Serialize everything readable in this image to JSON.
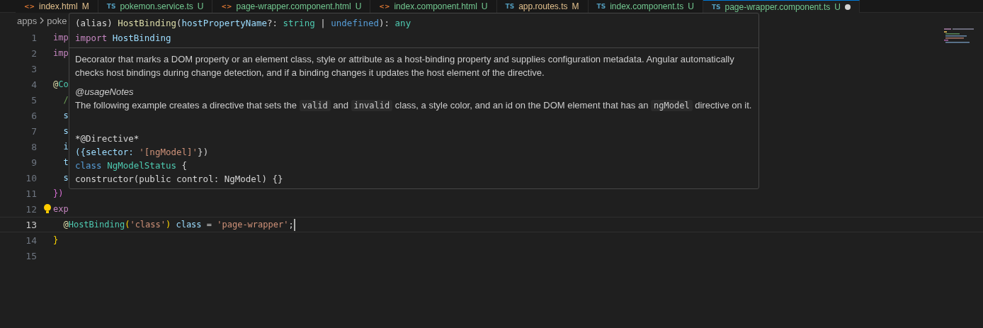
{
  "tabs": [
    {
      "kind": "html",
      "badge": "<>",
      "label": "index.html",
      "status": "M",
      "color": "#e2c08d",
      "selected": false,
      "dirty": false
    },
    {
      "kind": "ts",
      "badge": "TS",
      "label": "pokemon.service.ts",
      "status": "U",
      "color": "#73c991",
      "selected": false,
      "dirty": false
    },
    {
      "kind": "html",
      "badge": "<>",
      "label": "page-wrapper.component.html",
      "status": "U",
      "color": "#73c991",
      "selected": false,
      "dirty": false
    },
    {
      "kind": "html",
      "badge": "<>",
      "label": "index.component.html",
      "status": "U",
      "color": "#73c991",
      "selected": false,
      "dirty": false
    },
    {
      "kind": "ts",
      "badge": "TS",
      "label": "app.routes.ts",
      "status": "M",
      "color": "#e2c08d",
      "selected": false,
      "dirty": false
    },
    {
      "kind": "ts",
      "badge": "TS",
      "label": "index.component.ts",
      "status": "U",
      "color": "#73c991",
      "selected": false,
      "dirty": false
    },
    {
      "kind": "ts",
      "badge": "TS",
      "label": "page-wrapper.component.ts",
      "status": "U",
      "color": "#73c991",
      "selected": true,
      "dirty": true
    }
  ],
  "breadcrumb": [
    "apps",
    "poke"
  ],
  "lines": [
    {
      "number": "1",
      "current": false,
      "bulb": false,
      "tokens": [
        {
          "text": "imp",
          "kind": "keyword"
        }
      ]
    },
    {
      "number": "2",
      "current": false,
      "bulb": false,
      "tokens": [
        {
          "text": "imp",
          "kind": "keyword"
        }
      ]
    },
    {
      "number": "3",
      "current": false,
      "bulb": false
    },
    {
      "number": "4",
      "current": false,
      "bulb": false,
      "tokens": [
        {
          "text": "@",
          "kind": "func"
        },
        {
          "text": "Co",
          "kind": "type"
        }
      ]
    },
    {
      "number": "5",
      "current": false,
      "bulb": false,
      "tokens": [
        {
          "text": "  /",
          "kind": "comment"
        }
      ]
    },
    {
      "number": "6",
      "current": false,
      "bulb": false,
      "tokens": [
        {
          "text": "  s",
          "kind": "variable"
        }
      ]
    },
    {
      "number": "7",
      "current": false,
      "bulb": false,
      "tokens": [
        {
          "text": "  s",
          "kind": "variable"
        }
      ]
    },
    {
      "number": "8",
      "current": false,
      "bulb": false,
      "tokens": [
        {
          "text": "  i",
          "kind": "variable"
        }
      ]
    },
    {
      "number": "9",
      "current": false,
      "bulb": false,
      "tokens": [
        {
          "text": "  t",
          "kind": "variable"
        }
      ]
    },
    {
      "number": "10",
      "current": false,
      "bulb": false,
      "tokens": [
        {
          "text": "  s",
          "kind": "variable"
        }
      ]
    },
    {
      "number": "11",
      "current": false,
      "bulb": false,
      "tokens": [
        {
          "text": "})",
          "kind": "bracket"
        }
      ]
    },
    {
      "number": "12",
      "current": false,
      "bulb": true,
      "tokens": [
        {
          "text": "exp",
          "kind": "keyword"
        }
      ]
    },
    {
      "number": "13",
      "current": true,
      "bulb": false,
      "tokens": [
        {
          "text": "  @",
          "kind": "func"
        },
        {
          "text": "HostBinding",
          "kind": "type"
        },
        {
          "text": "(",
          "kind": "bracket2"
        },
        {
          "text": "'class'",
          "kind": "string"
        },
        {
          "text": ")",
          "kind": "bracket2"
        },
        {
          "text": " class",
          "kind": "variable"
        },
        {
          "text": " = ",
          "kind": "plain"
        },
        {
          "text": "'page-wrapper'",
          "kind": "string"
        },
        {
          "text": ";",
          "kind": "plain"
        }
      ]
    },
    {
      "number": "14",
      "current": false,
      "bulb": false,
      "tokens": [
        {
          "text": "}",
          "kind": "bracket2"
        }
      ]
    },
    {
      "number": "15",
      "current": false,
      "bulb": false
    }
  ],
  "hover": {
    "signature": [
      {
        "text": "(alias) ",
        "kind": "plain"
      },
      {
        "text": "HostBinding",
        "kind": "func"
      },
      {
        "text": "(",
        "kind": "plain"
      },
      {
        "text": "hostPropertyName",
        "kind": "variable"
      },
      {
        "text": "?: ",
        "kind": "plain"
      },
      {
        "text": "string",
        "kind": "type"
      },
      {
        "text": " | ",
        "kind": "plain"
      },
      {
        "text": "undefined",
        "kind": "blue"
      },
      {
        "text": "): ",
        "kind": "plain"
      },
      {
        "text": "any",
        "kind": "type"
      }
    ],
    "import": [
      {
        "text": "import",
        "kind": "keyword"
      },
      {
        "text": " HostBinding",
        "kind": "variable"
      }
    ],
    "description": "Decorator that marks a DOM property or an element class, style or attribute as a host-binding property and supplies configuration metadata. Angular automatically checks host bindings during change detection, and if a binding changes it updates the host element of the directive.",
    "notes_heading": "@usageNotes",
    "notes": [
      {
        "text": "The following example creates a directive that sets the ",
        "kind": "text"
      },
      {
        "text": "valid",
        "kind": "code"
      },
      {
        "text": " and ",
        "kind": "text"
      },
      {
        "text": "invalid",
        "kind": "code"
      },
      {
        "text": " class, a style color, and an id on the DOM element that has an ",
        "kind": "text"
      },
      {
        "text": "ngModel",
        "kind": "code"
      },
      {
        "text": " directive on it.",
        "kind": "text"
      }
    ],
    "example": [
      [
        {
          "text": "*@Directive*",
          "kind": "plain"
        }
      ],
      [
        {
          "text": "({selector: ",
          "kind": "variable"
        },
        {
          "text": "'[ngModel]'",
          "kind": "string"
        },
        {
          "text": "})",
          "kind": "plain"
        }
      ],
      [
        {
          "text": "class ",
          "kind": "blue"
        },
        {
          "text": "NgModelStatus",
          "kind": "type"
        },
        {
          "text": " {",
          "kind": "plain"
        }
      ],
      [
        {
          "text": "constructor(public control: NgModel) {}",
          "kind": "plain"
        }
      ]
    ]
  }
}
